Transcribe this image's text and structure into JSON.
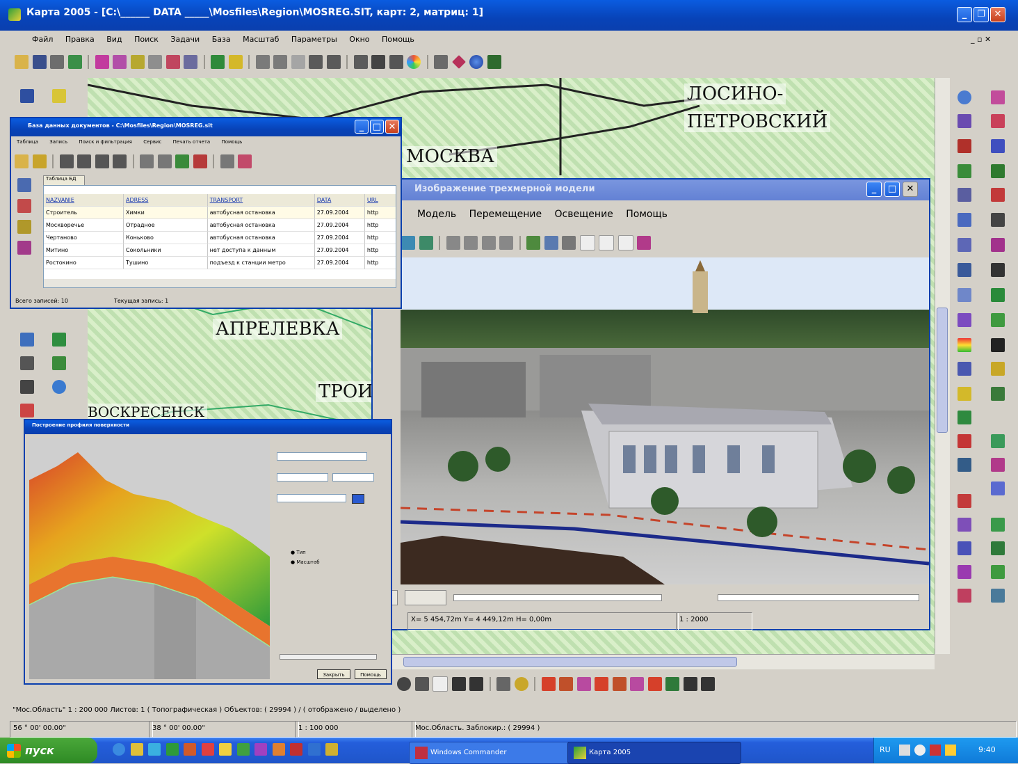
{
  "main_window": {
    "title": "Карта 2005 - [С:\\______ DATA _____\\Mosfiles\\Region\\MOSREG.SIT, карт: 2, матриц: 1]",
    "menu": [
      "Файл",
      "Правка",
      "Вид",
      "Поиск",
      "Задачи",
      "База",
      "Масштаб",
      "Параметры",
      "Окно",
      "Помощь"
    ]
  },
  "map": {
    "labels": [
      "ЛОСИНО-",
      "ПЕТРОВСКИЙ",
      "МОСКВА",
      "АПРЕЛЕВКА",
      "ТРОИ",
      "ВОСКРЕСЕНСК"
    ]
  },
  "db_window": {
    "title": "База данных документов - С:\\Mosfiles\\Region\\MOSREG.sit",
    "menu": [
      "Таблица",
      "Запись",
      "Поиск и фильтрация",
      "Сервис",
      "Печать отчета",
      "Помощь"
    ],
    "tab": "Таблица БД",
    "columns": [
      "NAZVANIE",
      "ADRESS",
      "TRANSPORT",
      "DATA",
      "URL"
    ],
    "rows": [
      [
        "Строитель",
        "Химки",
        "автобусная остановка",
        "27.09.2004",
        "http"
      ],
      [
        "Москворечье",
        "Отрадное",
        "автобусная остановка",
        "27.09.2004",
        "http"
      ],
      [
        "Чертаново",
        "Коньково",
        "автобусная остановка",
        "27.09.2004",
        "http"
      ],
      [
        "Митино",
        "Сокольники",
        "нет доступа к данным",
        "27.09.2004",
        "http"
      ],
      [
        "Ростокино",
        "Тушино",
        "подъезд к станции метро",
        "27.09.2004",
        "http"
      ]
    ],
    "status": [
      "Всего записей: 10",
      "Текущая запись: 1"
    ]
  },
  "model_window": {
    "title": "Изображение трехмерной модели",
    "menu": [
      "Модель",
      "Перемещение",
      "Освещение",
      "Помощь"
    ],
    "status_coords": "X= 5 454,72m  Y= 4 449,12m  H= 0,00m",
    "status_scale": "1 : 2000"
  },
  "profile_window": {
    "title": "Построение профиля поверхности",
    "options": [
      "Тип",
      "Масштаб"
    ],
    "buttons": [
      "Закрыть",
      "Помощь"
    ]
  },
  "statusbar": {
    "line1": "\"Мос.Область\"    1 : 200 000   Листов: 1   ( Топографическая )   Объектов: ( 29994 ) / ( отображено / выделено )",
    "seg_lat": "56 ° 00' 00.00\"",
    "seg_lon": "38 ° 00' 00.00\"",
    "seg_scale": "1 : 100 000",
    "seg_info": "Мос.Область. Заблокир.: ( 29994 )"
  },
  "taskbar": {
    "start_label": "пуск",
    "tasks": [
      "Windows Commander",
      "Карта 2005"
    ],
    "clock": "9:40",
    "lang": "RU"
  },
  "colors": {
    "xp_blue": "#0a4fd3",
    "taskbar": "#245edb",
    "start_green": "#3c9a2c"
  }
}
